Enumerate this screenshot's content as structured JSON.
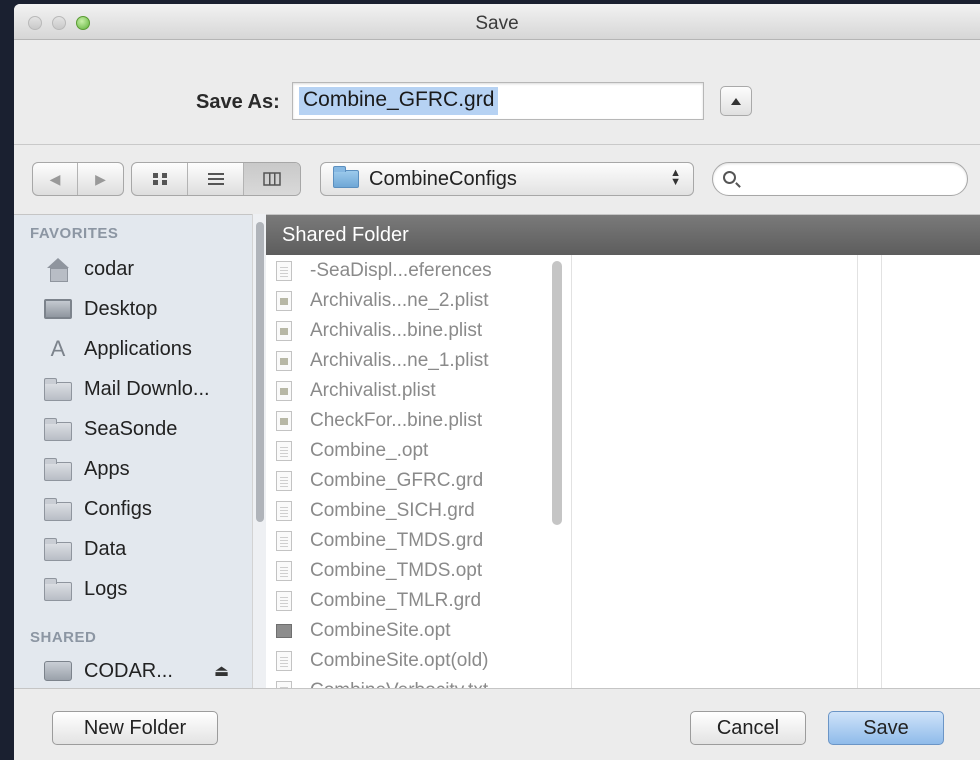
{
  "window": {
    "title": "Save"
  },
  "save_as": {
    "label": "Save As:",
    "value": "Combine_GFRC.grd"
  },
  "toolbar": {
    "back_glyph": "◀",
    "forward_glyph": "▶",
    "view_icons": [
      "icon-view-icon",
      "list-view-icon",
      "column-view-icon"
    ],
    "active_view": "column",
    "location": "CombineConfigs",
    "search_placeholder": ""
  },
  "sidebar": {
    "favorites_heading": "FAVORITES",
    "favorites": [
      {
        "label": "codar",
        "icon": "home-icon"
      },
      {
        "label": "Desktop",
        "icon": "desktop-icon"
      },
      {
        "label": "Applications",
        "icon": "applications-icon"
      },
      {
        "label": "Mail Downlo...",
        "icon": "folder-icon"
      },
      {
        "label": "SeaSonde",
        "icon": "folder-icon"
      },
      {
        "label": "Apps",
        "icon": "folder-icon"
      },
      {
        "label": "Configs",
        "icon": "folder-icon"
      },
      {
        "label": "Data",
        "icon": "folder-icon"
      },
      {
        "label": "Logs",
        "icon": "folder-icon"
      }
    ],
    "shared_heading": "SHARED",
    "shared": [
      {
        "label": "CODAR...",
        "icon": "server-icon",
        "eject": "⏏"
      }
    ]
  },
  "browser": {
    "column_header": "Shared Folder",
    "files": [
      {
        "name": "-SeaDispl...eferences",
        "icon": "document-icon"
      },
      {
        "name": "Archivalis...ne_2.plist",
        "icon": "plist-icon"
      },
      {
        "name": "Archivalis...bine.plist",
        "icon": "plist-icon"
      },
      {
        "name": "Archivalis...ne_1.plist",
        "icon": "plist-icon"
      },
      {
        "name": "Archivalist.plist",
        "icon": "plist-icon"
      },
      {
        "name": "CheckFor...bine.plist",
        "icon": "plist-icon"
      },
      {
        "name": "Combine_.opt",
        "icon": "document-icon"
      },
      {
        "name": "Combine_GFRC.grd",
        "icon": "document-icon"
      },
      {
        "name": "Combine_SICH.grd",
        "icon": "document-icon"
      },
      {
        "name": "Combine_TMDS.grd",
        "icon": "document-icon"
      },
      {
        "name": "Combine_TMDS.opt",
        "icon": "document-icon"
      },
      {
        "name": "Combine_TMLR.grd",
        "icon": "document-icon"
      },
      {
        "name": "CombineSite.opt",
        "icon": "application-file-icon"
      },
      {
        "name": "CombineSite.opt(old)",
        "icon": "document-icon"
      },
      {
        "name": "CombineVerbocity.txt",
        "icon": "document-icon"
      }
    ]
  },
  "buttons": {
    "new_folder": "New Folder",
    "cancel": "Cancel",
    "save": "Save"
  },
  "colors": {
    "default_button": "#8fbbea",
    "selection": "#b6d2f3",
    "column_header": "#5d5d5d",
    "sidebar_bg": "#e3e8ee"
  }
}
